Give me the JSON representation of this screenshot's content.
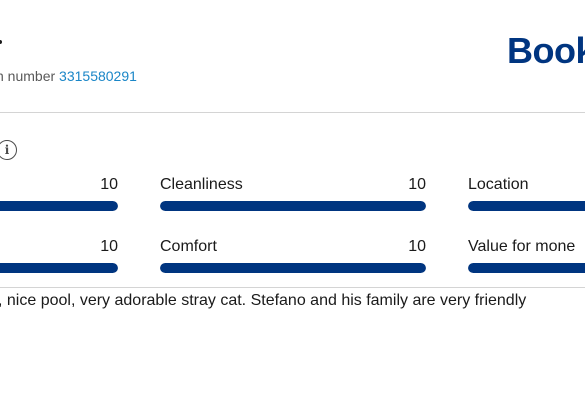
{
  "reservation": {
    "label": "n number",
    "number": "3315580291"
  },
  "logo": {
    "text": "Book"
  },
  "ratings": [
    {
      "label": "",
      "score": "10",
      "fraction": 1.0
    },
    {
      "label": "Cleanliness",
      "score": "10",
      "fraction": 1.0
    },
    {
      "label": "Location",
      "score": "",
      "fraction": 1.0
    },
    {
      "label": "",
      "score": "10",
      "fraction": 1.0
    },
    {
      "label": "Comfort",
      "score": "10",
      "fraction": 1.0
    },
    {
      "label": "Value for mone",
      "score": "",
      "fraction": 1.0
    }
  ],
  "review": {
    "text": ", nice pool, very adorable stray cat. Stefano and his family are very friendly"
  },
  "colors": {
    "brand": "#003580",
    "link": "#1a86c7"
  },
  "icons": {
    "info": "info-icon"
  }
}
